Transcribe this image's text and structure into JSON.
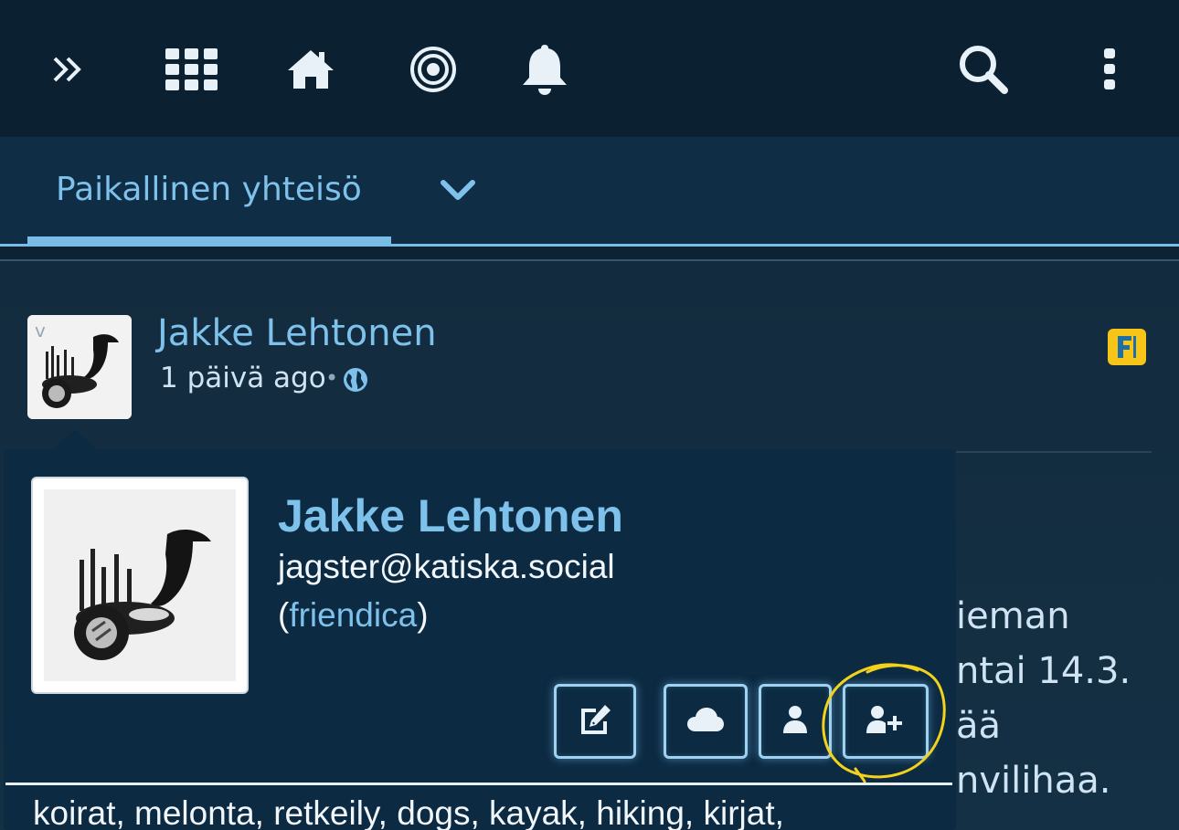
{
  "nav": {
    "icons": [
      "double-chevron-right-icon",
      "apps-grid-icon",
      "home-icon",
      "target-icon",
      "bell-icon",
      "search-icon",
      "more-vertical-icon"
    ]
  },
  "tabs": {
    "active_label": "Paikallinen yhteisö"
  },
  "post": {
    "author": "Jakke Lehtonen",
    "time": "1 päivä ago",
    "separator": "•",
    "caret": "v",
    "body_fragments": [
      "ieman",
      "ntai 14.3.",
      "ää",
      "nvilihaa."
    ]
  },
  "hovercard": {
    "name": "Jakke Lehtonen",
    "address": "jagster@katiska.social",
    "network_open": "(",
    "network": "friendica",
    "network_close": ")",
    "tags": "koirat, melonta, retkeily, dogs, kayak, hiking, kirjat,",
    "actions": [
      "edit-icon",
      "cloud-icon",
      "user-icon",
      "user-plus-icon"
    ]
  },
  "colors": {
    "accent": "#7ec1ea",
    "background": "#0d2233",
    "card": "#0c2a42",
    "highlight": "#f2d21b",
    "network_badge_yellow": "#f7c418",
    "network_badge_blue": "#1d6fa5"
  }
}
